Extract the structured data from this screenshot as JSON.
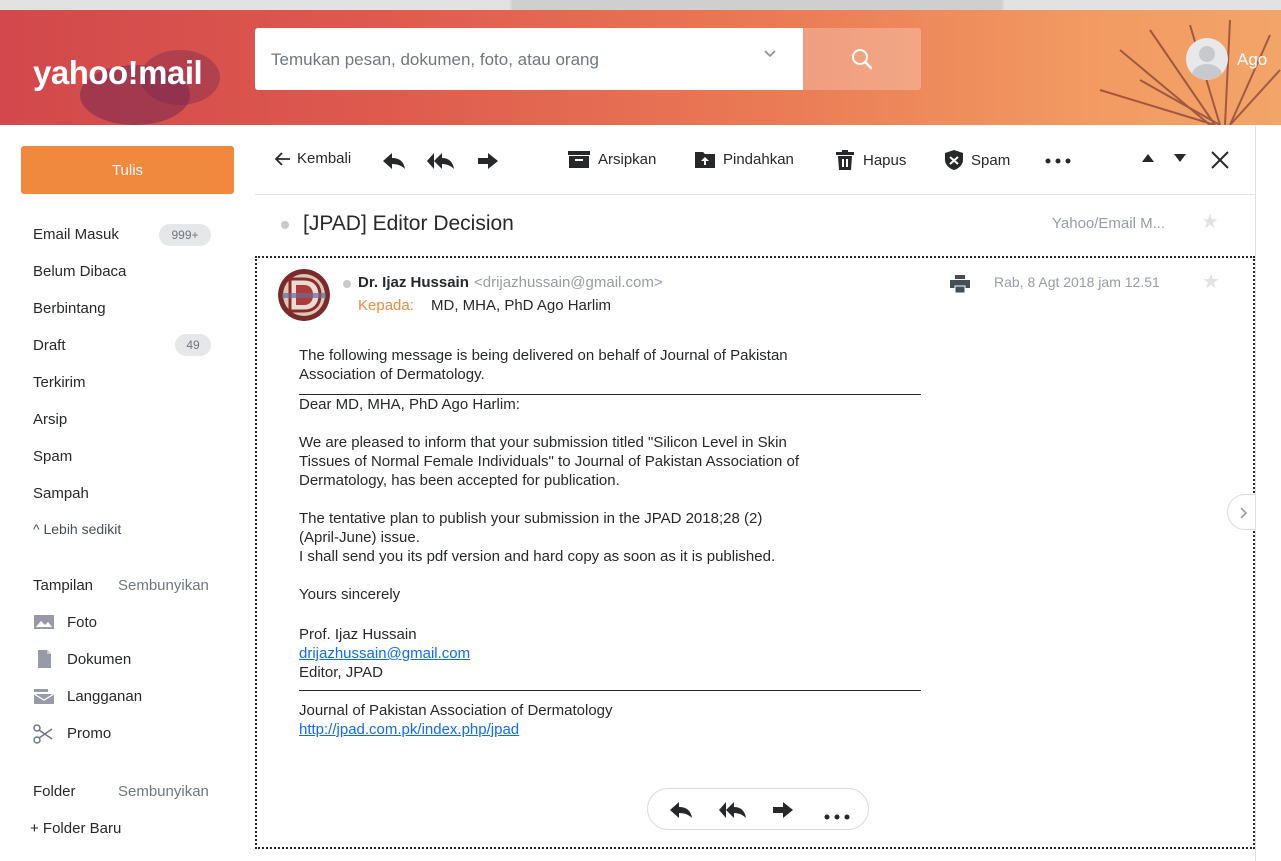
{
  "header": {
    "logo": "yahoo!mail",
    "search_placeholder": "Temukan pesan, dokumen, foto, atau orang",
    "user_name": "Ago"
  },
  "sidebar": {
    "compose_label": "Tulis",
    "items": [
      {
        "label": "Email Masuk",
        "badge": "999+"
      },
      {
        "label": "Belum Dibaca"
      },
      {
        "label": "Berbintang"
      },
      {
        "label": "Draft",
        "badge": "49"
      },
      {
        "label": "Terkirim"
      },
      {
        "label": "Arsip"
      },
      {
        "label": "Spam"
      },
      {
        "label": "Sampah"
      },
      {
        "label": "^ Lebih sedikit"
      }
    ],
    "views_title": "Tampilan",
    "views_hide": "Sembunyikan",
    "views": [
      {
        "label": "Foto",
        "icon": "photo-icon"
      },
      {
        "label": "Dokumen",
        "icon": "document-icon"
      },
      {
        "label": "Langganan",
        "icon": "subscription-icon"
      },
      {
        "label": "Promo",
        "icon": "scissors-icon"
      }
    ],
    "folders_title": "Folder",
    "folders_hide": "Sembunyikan",
    "new_folder": "+ Folder Baru"
  },
  "toolbar": {
    "back": "Kembali",
    "archive": "Arsipkan",
    "move": "Pindahkan",
    "delete": "Hapus",
    "spam": "Spam"
  },
  "message": {
    "subject": "[JPAD] Editor Decision",
    "folder": "Yahoo/Email M...",
    "sender_name": "Dr. Ijaz Hussain",
    "sender_email": "<drijazhussain@gmail.com>",
    "to_label": "Kepada:",
    "to_value": "MD, MHA, PhD Ago Harlim",
    "date": "Rab, 8 Agt 2018 jam 12.51",
    "body": {
      "intro_1": "The following message is being delivered on behalf of Journal of Pakistan",
      "intro_2": "Association of Dermatology.",
      "greeting": "Dear MD, MHA, PhD Ago Harlim:",
      "p1_1": "We are pleased to inform that your submission titled \"Silicon Level in Skin",
      "p1_2": "Tissues of Normal Female Individuals\" to Journal of Pakistan Association of",
      "p1_3": "Dermatology, has been accepted for publication.",
      "p2_1": "The tentative plan to publish your submission in the JPAD 2018;28 (2)",
      "p2_2": "(April-June) issue.",
      "p2_3": "I shall send you its pdf version and hard copy as soon as it is published.",
      "closing": "Yours sincerely",
      "sig_name": "Prof. Ijaz Hussain",
      "sig_email": "drijazhussain@gmail.com",
      "sig_title": "Editor, JPAD",
      "journal": "Journal of Pakistan Association of Dermatology",
      "journal_url": "http://jpad.com.pk/index.php/jpad"
    }
  },
  "colors": {
    "accent": "#f0883e",
    "link": "#0f69ff",
    "header_start": "#d2484c",
    "header_end": "#f3a469"
  }
}
